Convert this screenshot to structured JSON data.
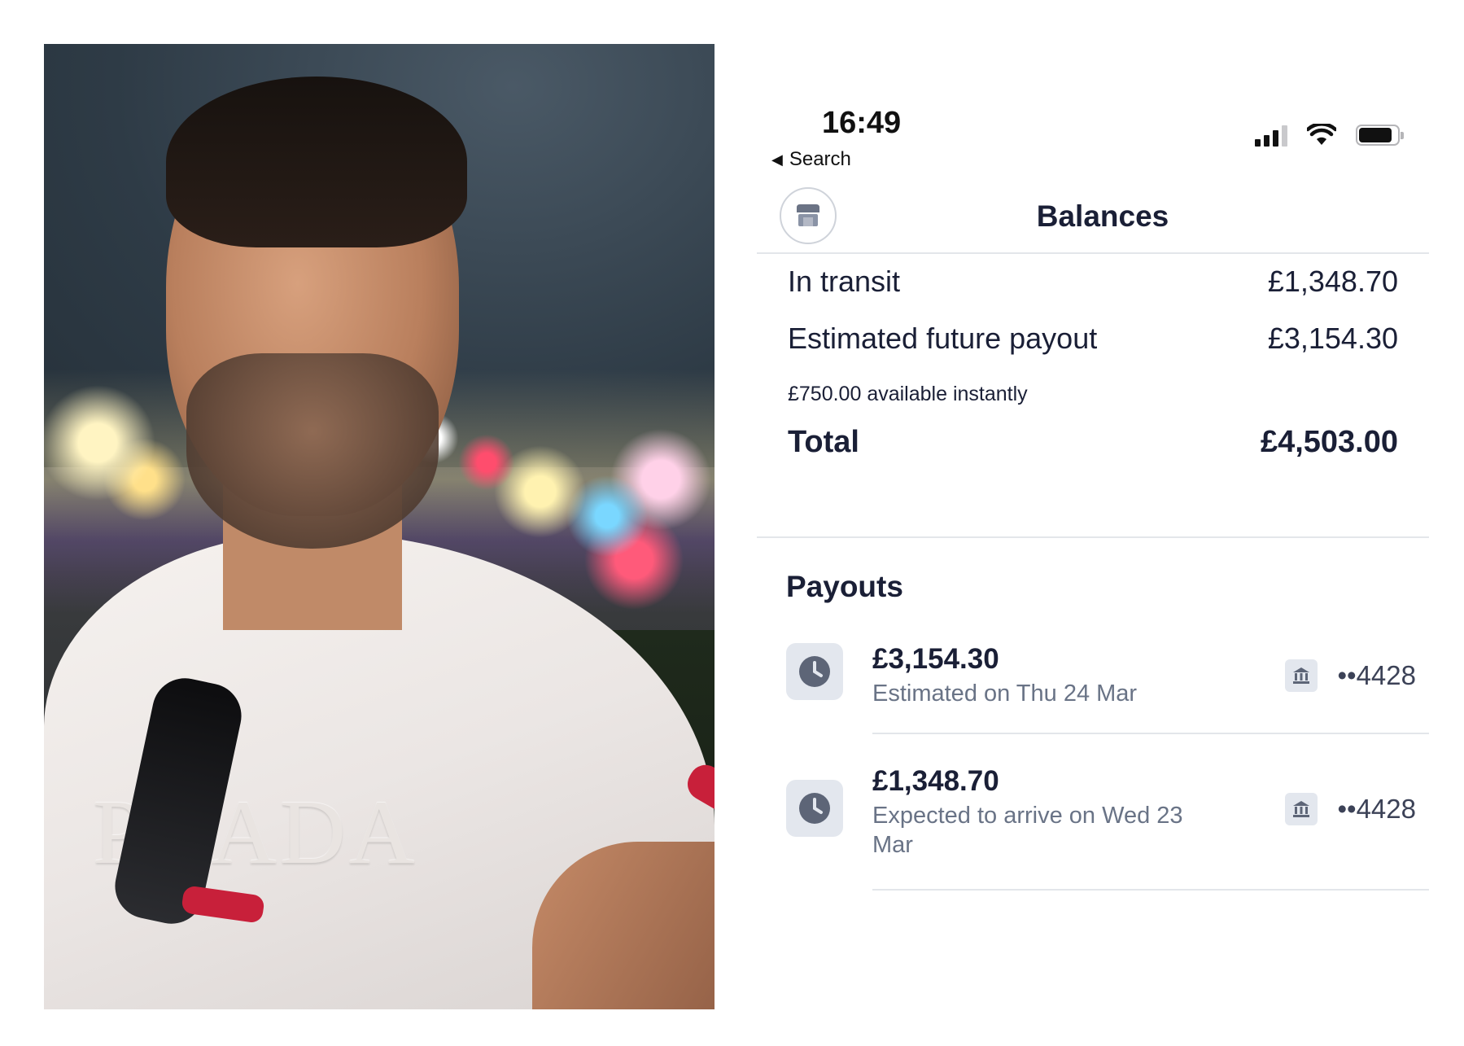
{
  "status_bar": {
    "time": "16:49",
    "back_label": "Search",
    "icons": [
      "cellular-signal-icon",
      "wifi-icon",
      "battery-icon"
    ]
  },
  "header": {
    "title": "Balances",
    "store_icon": "storefront-icon"
  },
  "balances": {
    "in_transit_label": "In transit",
    "in_transit_value": "£1,348.70",
    "future_payout_label": "Estimated future payout",
    "future_payout_value": "£3,154.30",
    "instant_note": "£750.00 available instantly",
    "total_label": "Total",
    "total_value": "£4,503.00"
  },
  "payouts": {
    "section_title": "Payouts",
    "items": [
      {
        "amount": "£3,154.30",
        "subtitle": "Estimated on Thu 24 Mar",
        "account": "••4428",
        "status_icon": "clock-icon",
        "bank_icon": "bank-icon"
      },
      {
        "amount": "£1,348.70",
        "subtitle": "Expected to arrive on Wed 23 Mar",
        "account": "••4428",
        "status_icon": "clock-icon",
        "bank_icon": "bank-icon"
      }
    ]
  },
  "photo": {
    "shirt_brand_text": "PRADA"
  },
  "colors": {
    "text_primary": "#1a1f36",
    "text_secondary": "#697386",
    "divider": "#e3e6ea",
    "icon_bg": "#e3e7ee"
  }
}
